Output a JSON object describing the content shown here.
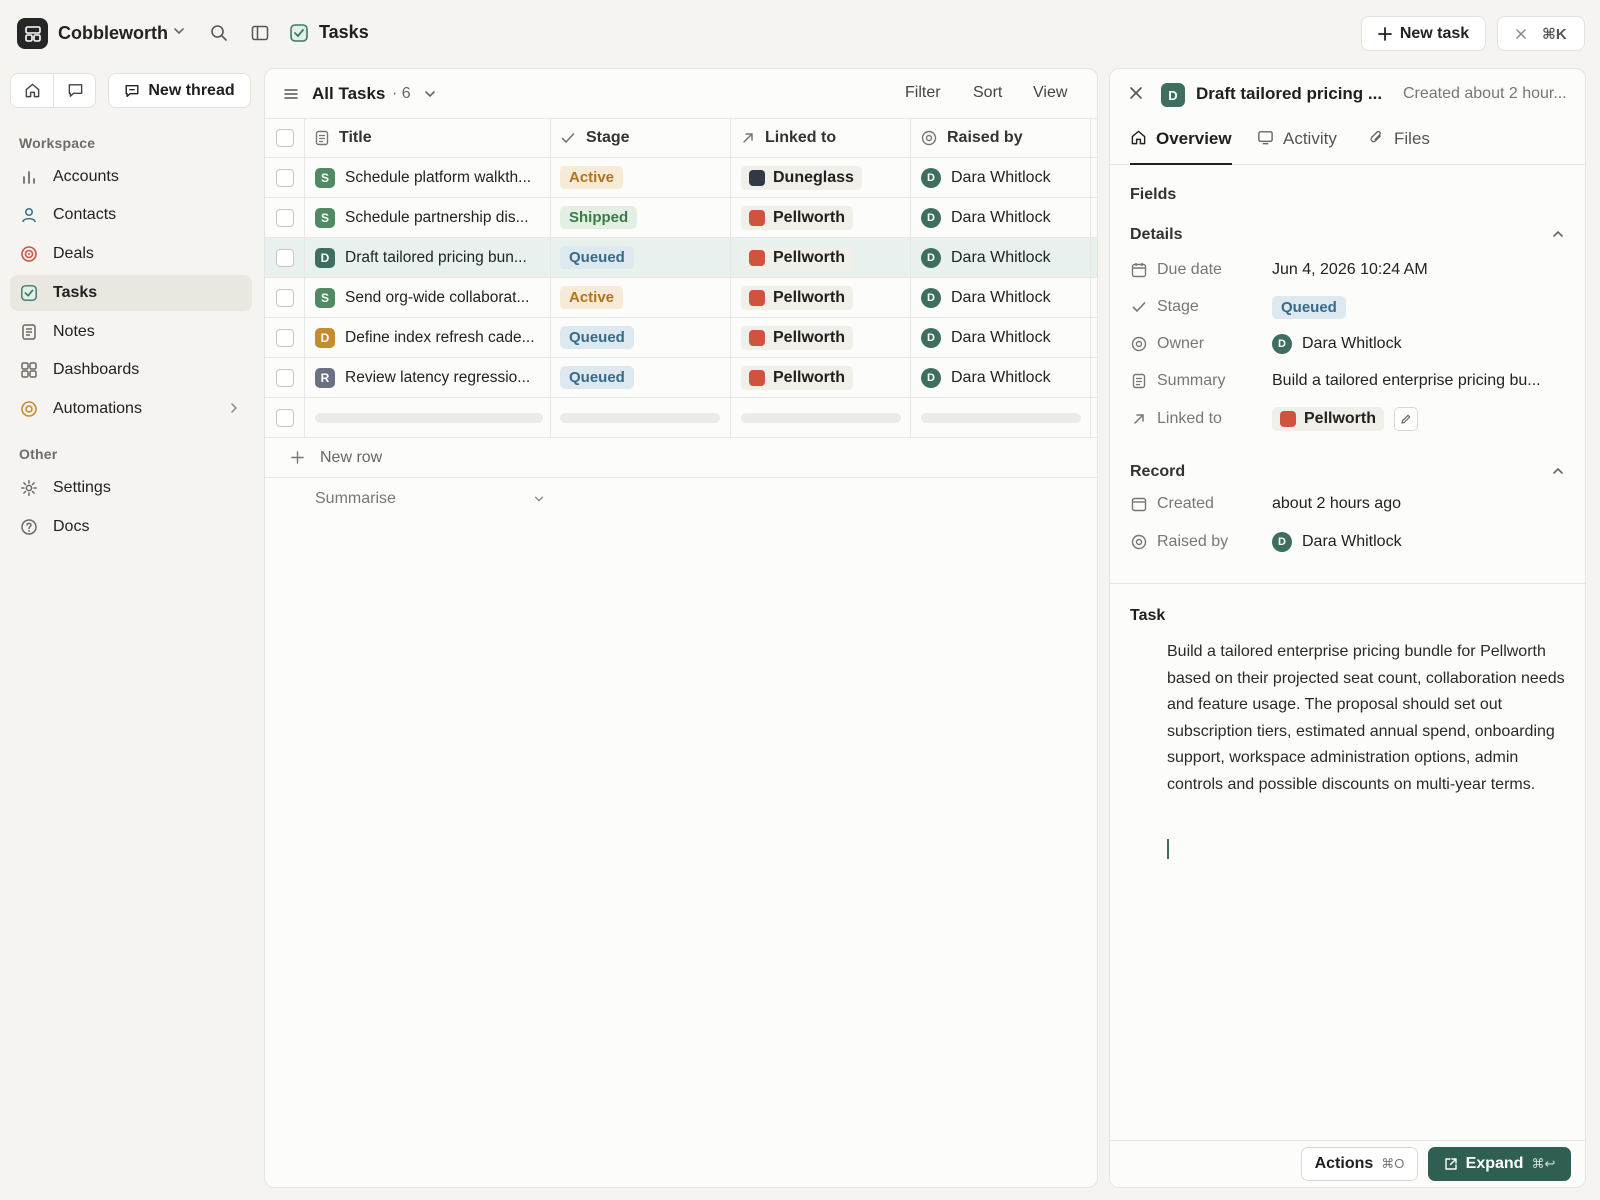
{
  "app": {
    "name": "Cobbleworth",
    "page_title": "Tasks"
  },
  "toolbar": {
    "new_task_label": "New task",
    "cmdk_label": "⌘K"
  },
  "sidebar": {
    "new_thread_label": "New thread",
    "workspace_label": "Workspace",
    "other_label": "Other",
    "items": [
      {
        "label": "Accounts",
        "icon": "bar-chart-icon"
      },
      {
        "label": "Contacts",
        "icon": "person-icon"
      },
      {
        "label": "Deals",
        "icon": "target-icon"
      },
      {
        "label": "Tasks",
        "icon": "checkbox-icon",
        "active": true
      },
      {
        "label": "Notes",
        "icon": "note-icon"
      },
      {
        "label": "Dashboards",
        "icon": "grid-icon"
      },
      {
        "label": "Automations",
        "icon": "automation-icon"
      }
    ],
    "other_items": [
      {
        "label": "Settings",
        "icon": "gear-icon"
      },
      {
        "label": "Docs",
        "icon": "help-icon"
      }
    ]
  },
  "table": {
    "view_title": "All Tasks",
    "count": "· 6",
    "actions": {
      "filter": "Filter",
      "sort": "Sort",
      "view": "View"
    },
    "columns": {
      "title": "Title",
      "stage": "Stage",
      "linked": "Linked to",
      "raised": "Raised by"
    },
    "rows": [
      {
        "badge": "S",
        "badge_color": "#4f8a63",
        "title": "Schedule platform walkth...",
        "stage": "Active",
        "linked": "Duneglass",
        "linked_color": "#2f3a44",
        "raised": "Dara Whitlock"
      },
      {
        "badge": "S",
        "badge_color": "#4f8a63",
        "title": "Schedule partnership dis...",
        "stage": "Shipped",
        "linked": "Pellworth",
        "linked_color": "#d0533f",
        "raised": "Dara Whitlock"
      },
      {
        "badge": "D",
        "badge_color": "#3d6e5f",
        "title": "Draft tailored pricing bun...",
        "stage": "Queued",
        "linked": "Pellworth",
        "linked_color": "#d0533f",
        "raised": "Dara Whitlock",
        "selected": true
      },
      {
        "badge": "S",
        "badge_color": "#4f8a63",
        "title": "Send org-wide collaborat...",
        "stage": "Active",
        "linked": "Pellworth",
        "linked_color": "#d0533f",
        "raised": "Dara Whitlock"
      },
      {
        "badge": "D",
        "badge_color": "#c88a2e",
        "title": "Define index refresh cade...",
        "stage": "Queued",
        "linked": "Pellworth",
        "linked_color": "#d0533f",
        "raised": "Dara Whitlock"
      },
      {
        "badge": "R",
        "badge_color": "#6a7182",
        "title": "Review latency regressio...",
        "stage": "Queued",
        "linked": "Pellworth",
        "linked_color": "#d0533f",
        "raised": "Dara Whitlock"
      }
    ],
    "stage_colors": {
      "Active": {
        "bg": "#f7ead6",
        "fg": "#b5701c"
      },
      "Shipped": {
        "bg": "#e3efe3",
        "fg": "#3b7a45"
      },
      "Queued": {
        "bg": "#dde8ef",
        "fg": "#356a8c"
      }
    },
    "new_row_label": "New row",
    "summarise_label": "Summarise"
  },
  "detail": {
    "badge": "D",
    "title": "Draft tailored pricing ...",
    "created_short": "Created about 2 hour...",
    "tabs": {
      "overview": "Overview",
      "activity": "Activity",
      "files": "Files"
    },
    "fields_heading": "Fields",
    "details_heading": "Details",
    "due_label": "Due date",
    "due_value": "Jun 4, 2026 10:24 AM",
    "stage_label": "Stage",
    "stage_value": "Queued",
    "owner_label": "Owner",
    "owner_value": "Dara Whitlock",
    "summary_label": "Summary",
    "summary_value": "Build a tailored enterprise pricing bu...",
    "linked_label": "Linked to",
    "linked_value": "Pellworth",
    "record_heading": "Record",
    "created_label": "Created",
    "created_value": "about 2 hours ago",
    "raised_label": "Raised by",
    "raised_value": "Dara Whitlock",
    "task_heading": "Task",
    "task_body": "Build a tailored enterprise pricing bundle for Pellworth based on their projected seat count, collaboration needs and feature usage. The proposal should set out subscription tiers, estimated annual spend, onboarding support, workspace administration options, admin controls and possible discounts on multi-year terms.",
    "actions_label": "Actions",
    "actions_kbd": "⌘O",
    "expand_label": "Expand",
    "expand_kbd": "⌘↩"
  }
}
